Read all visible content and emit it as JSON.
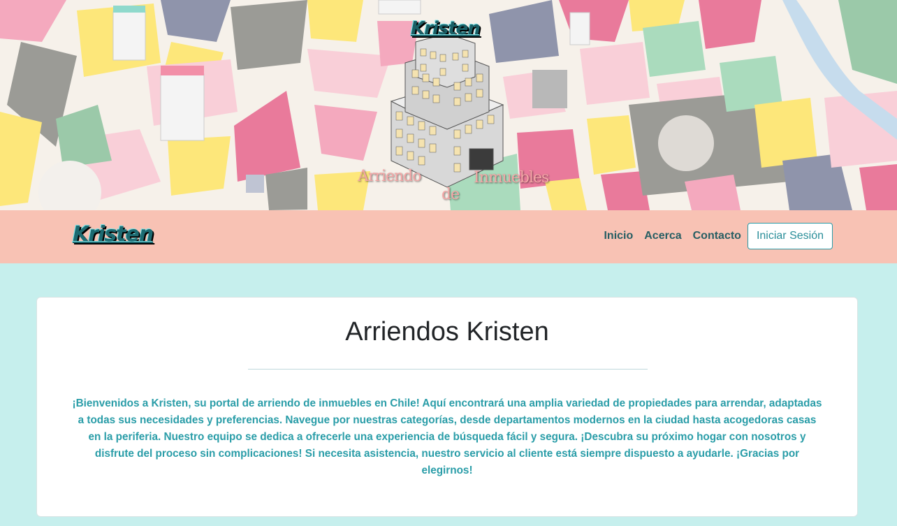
{
  "hero": {
    "logo_text": "Kristen",
    "tagline_word1": "Arriendo",
    "tagline_word2": "de",
    "tagline_word3": "Inmuebles"
  },
  "navbar": {
    "brand": "Kristen",
    "links": [
      "Inicio",
      "Acerca",
      "Contacto"
    ],
    "login_label": "Iniciar Sesión"
  },
  "main": {
    "title": "Arriendos Kristen",
    "paragraph": "¡Bienvenidos a Kristen, su portal de arriendo de inmuebles en Chile! Aquí encontrará una amplia variedad de propiedades para arrendar, adaptadas a todas sus necesidades y preferencias. Navegue por nuestras categorías, desde departamentos modernos en la ciudad hasta acogedoras casas en la periferia. Nuestro equipo se dedica a ofrecerle una experiencia de búsqueda fácil y segura. ¡Descubra su próximo hogar con nosotros y disfrute del proceso sin complicaciones! Si necesita asistencia, nuestro servicio al cliente está siempre dispuesto a ayudarle. ¡Gracias por elegirnos!"
  },
  "colors": {
    "navbar_bg": "#f8c2b4",
    "page_bg": "#c6efed",
    "accent": "#2a9da8",
    "nav_text": "#275e63"
  }
}
